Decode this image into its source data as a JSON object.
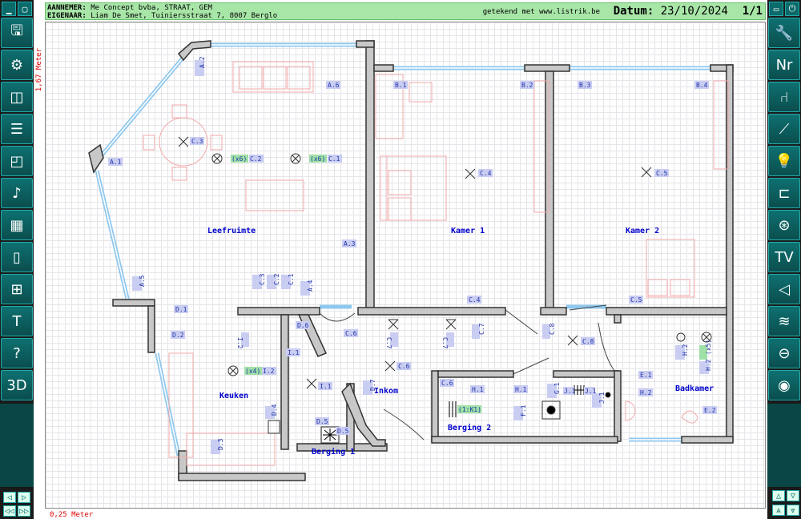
{
  "header": {
    "aannemer_label": "AANNEMER:",
    "aannemer_value": "Me Concept bvba, STRAAT, GEM",
    "eigenaar_label": "EIGENAAR:",
    "eigenaar_value": "Liam De Smet, Tuiniersstraat 7, 8007 Berglo",
    "drawn_by": "getekend met www.listrik.be",
    "date_label": "Datum:",
    "date_value": "23/10/2024",
    "pages": "1/1"
  },
  "scale": {
    "vertical": "1,67 Meter",
    "horizontal": "0,25 Meter"
  },
  "rooms": {
    "leefruimte": "Leefruimte",
    "kamer1": "Kamer 1",
    "kamer2": "Kamer 2",
    "keuken": "Keuken",
    "inkom": "Inkom",
    "berging1": "Berging 1",
    "berging2": "Berging 2",
    "badkamer": "Badkamer"
  },
  "labels": {
    "A2": "A.2",
    "A6": "A.6",
    "A1": "A.1",
    "A3": "A.3",
    "A4": "A.4",
    "A5": "A.5",
    "B1": "B.1",
    "B2": "B.2",
    "B3": "B.3",
    "B4": "B.4",
    "C1": "C.1",
    "C2": "C.2",
    "C3": "C.3",
    "C4": "C.4",
    "C5": "C.5",
    "C6": "C.6",
    "C7": "C.7",
    "C8": "C.8",
    "C2b": "C.2",
    "C3b": "C.3",
    "C1b": "C.1",
    "C4b": "C.4",
    "C5b": "C.5",
    "C6b": "C.6",
    "C6c": "C.6",
    "C7b": "C.7",
    "C7c": "C.7",
    "C8b": "C.8",
    "D1": "D.1",
    "D2": "D.2",
    "D3": "D.3",
    "D4": "D.4",
    "D5": "D.5",
    "D5b": "D.5",
    "D6": "D.6",
    "D7": "D.7",
    "E1": "E.1",
    "E2": "E.2",
    "F1": "F.1",
    "G1": "G.1",
    "H1": "H.1",
    "H1b": "H.1",
    "H2": "H.2",
    "H2b": "H.2",
    "H2c": "H.2",
    "I1": "I.1",
    "I1b": "I.1",
    "I2": "I.2",
    "I2b": "I.2",
    "J1": "J.1",
    "J1b": "J.1",
    "J1c": "J.1"
  },
  "badges": {
    "x6a": "(x6)",
    "x6b": "(x6)",
    "x4": "(x4)",
    "x5": "(x5)",
    "k1": "(1:K1)"
  },
  "icons": {
    "left": [
      "save-icon",
      "settings-icon",
      "camera-icon",
      "document-icon",
      "layout-icon",
      "guitar-icon",
      "blocks-icon",
      "door-icon",
      "window-icon",
      "text-icon",
      "help-icon",
      "3d-icon"
    ],
    "right": [
      "tools-icon",
      "numbering-icon",
      "chair-icon",
      "slash-icon",
      "bulb-icon",
      "plug-icon",
      "cooktop-icon",
      "tv-icon",
      "speaker-icon",
      "heating-icon",
      "socket-icon",
      "eye-icon"
    ]
  },
  "toolbar_text": {
    "nr": "Nr",
    "tv": "TV",
    "threeD": "3D",
    "T": "T",
    "help": "?"
  }
}
